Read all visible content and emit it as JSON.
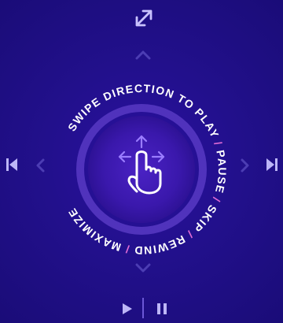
{
  "gesture": {
    "ring_text": "SWIPE DIRECTION TO PLAY",
    "ring_segments": [
      "PAUSE",
      "SKIP",
      "REWIND",
      "MAXIMIZE"
    ],
    "separator": "/"
  },
  "icons": {
    "top": "expand-icon",
    "up": "chevron-up-icon",
    "down": "chevron-down-icon",
    "left_chevron": "chevron-left-icon",
    "right_chevron": "chevron-right-icon",
    "skip_back": "skip-back-icon",
    "skip_forward": "skip-forward-icon",
    "hand": "swipe-hand-icon",
    "play": "play-icon",
    "pause": "pause-icon"
  },
  "colors": {
    "background": "#22108c",
    "ring": "#5f3fc9",
    "text": "#ffffff",
    "separator": "#e06bd5",
    "dim": "#4c3db3"
  }
}
